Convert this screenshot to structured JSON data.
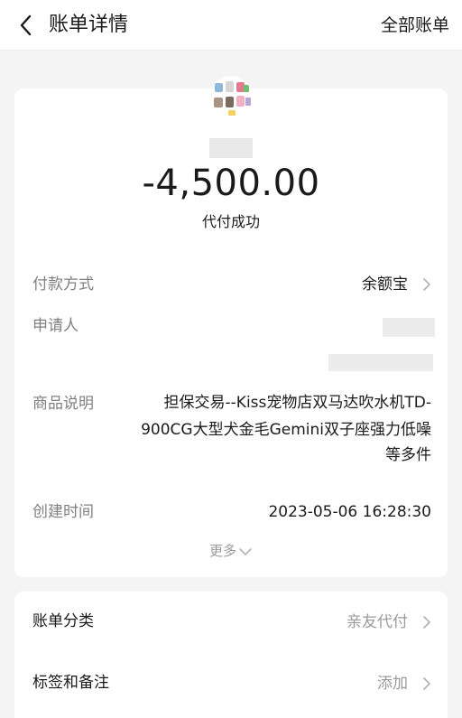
{
  "nav": {
    "title": "账单详情",
    "right_link": "全部账单",
    "back_icon": "chevron-left-icon"
  },
  "summary": {
    "amount": "-4,500.00",
    "status": "代付成功"
  },
  "details": {
    "payment_method": {
      "label": "付款方式",
      "value": "余额宝"
    },
    "applicant": {
      "label": "申请人"
    },
    "product": {
      "label": "商品说明",
      "lines": [
        "担保交易--Kiss宠物店双马达吹水机TD-",
        "900CG大型犬金毛Gemini双子座强力低噪",
        "等多件"
      ]
    },
    "created": {
      "label": "创建时间",
      "value": "2023-05-06 16:28:30"
    },
    "more": "更多"
  },
  "extra": {
    "category": {
      "label": "账单分类",
      "value": "亲友代付"
    },
    "tags": {
      "label": "标签和备注",
      "value": "添加"
    }
  },
  "colors": {
    "label_gray": "#808080",
    "muted_gray": "#9a9a9a",
    "card_bg": "#ffffff",
    "page_bg": "#f4f4f4"
  }
}
